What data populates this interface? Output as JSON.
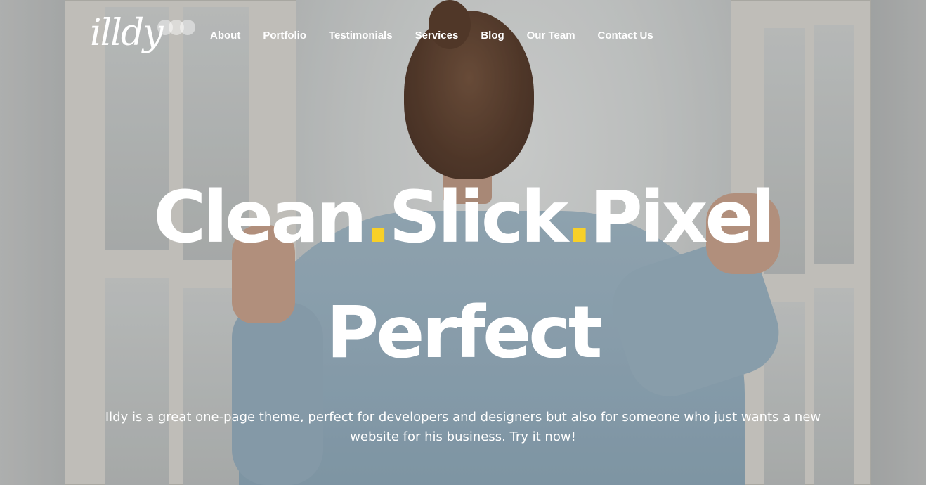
{
  "brand": {
    "logo_text": "illdy"
  },
  "nav": {
    "items": [
      {
        "label": "About"
      },
      {
        "label": "Portfolio"
      },
      {
        "label": "Testimonials"
      },
      {
        "label": "Services"
      },
      {
        "label": "Blog"
      },
      {
        "label": "Our Team"
      },
      {
        "label": "Contact Us"
      }
    ]
  },
  "hero": {
    "headline_part1": "Clean",
    "headline_sep1": ".",
    "headline_part2": "Slick",
    "headline_sep2": ".",
    "headline_part3": "Pixel",
    "headline_line2": "Perfect",
    "tagline": "Ildy is a great one-page theme, perfect for developers and designers but also for someone who just wants a new website for his business. Try it now!"
  },
  "colors": {
    "accent": "#f8d028",
    "text": "#ffffff"
  }
}
